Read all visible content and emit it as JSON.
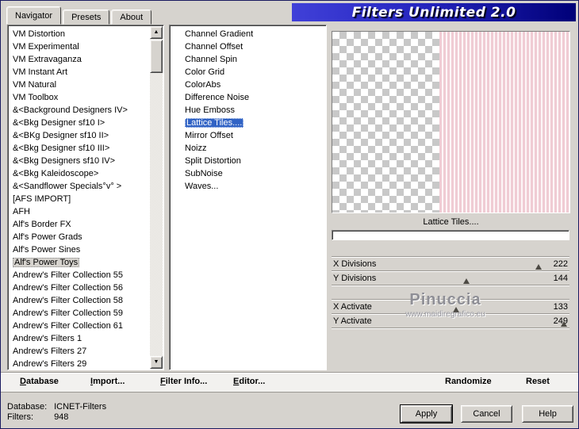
{
  "window": {
    "title": "Filters Unlimited 2.0",
    "tabs": [
      {
        "label": "Navigator",
        "active": true
      },
      {
        "label": "Presets",
        "active": false
      },
      {
        "label": "About",
        "active": false
      }
    ]
  },
  "navigator": {
    "categories": [
      "VM Distortion",
      "VM Experimental",
      "VM Extravaganza",
      "VM Instant Art",
      "VM Natural",
      "VM Toolbox",
      "&<Background Designers IV>",
      "&<Bkg Designer sf10 I>",
      "&<BKg Designer sf10 II>",
      "&<Bkg Designer sf10 III>",
      "&<Bkg Designers sf10 IV>",
      "&<Bkg Kaleidoscope>",
      "&<Sandflower Specials°v° >",
      "[AFS IMPORT]",
      "AFH",
      "Alf's Border FX",
      "Alf's Power Grads",
      "Alf's Power Sines",
      "Alf's Power Toys",
      "Andrew's Filter Collection 55",
      "Andrew's Filter Collection 56",
      "Andrew's Filter Collection 58",
      "Andrew's Filter Collection 59",
      "Andrew's Filter Collection 61",
      "Andrew's Filters 1",
      "Andrew's Filters 27",
      "Andrew's Filters 29"
    ],
    "selected_category": "Alf's Power Toys",
    "filters": [
      "Channel Gradient",
      "Channel Offset",
      "Channel Spin",
      "Color Grid",
      "ColorAbs",
      "Difference Noise",
      "Hue Emboss",
      "Lattice Tiles....",
      "Mirror Offset",
      "Noizz",
      "Split Distortion",
      "SubNoise",
      "Waves..."
    ],
    "selected_filter": "Lattice Tiles...."
  },
  "controls": {
    "filter_name": "Lattice Tiles....",
    "param_groups": [
      [
        {
          "label": "X Divisions",
          "value": 222
        },
        {
          "label": "Y Divisions",
          "value": 144
        }
      ],
      [
        {
          "label": "X Activate",
          "value": 133
        },
        {
          "label": "Y Activate",
          "value": 249
        }
      ]
    ],
    "slider_max": 255,
    "watermark_line1": "Pinuccia",
    "watermark_line2": "www.maidiregrafico.eu"
  },
  "toolbar": {
    "database_label": "Database",
    "import_label": "Import...",
    "filter_info_label": "Filter Info...",
    "editor_label": "Editor...",
    "randomize_label": "Randomize",
    "reset_label": "Reset"
  },
  "statusbar": {
    "database_label": "Database:",
    "database_value": "ICNET-Filters",
    "filters_label": "Filters:",
    "filters_value": "948",
    "apply_label": "Apply",
    "cancel_label": "Cancel",
    "help_label": "Help"
  },
  "icons": {
    "scroll_up": "▲",
    "scroll_down": "▼"
  },
  "colors": {
    "face": "#d6d3ce",
    "selection_blue": "#3163c5",
    "banner_blue": "#2626c0",
    "banner_blue_light": "#4040d8",
    "banner_blue_dark": "#000078",
    "stripe_pink": "#f0ccd4",
    "checker_gray": "#c8c8c8"
  }
}
